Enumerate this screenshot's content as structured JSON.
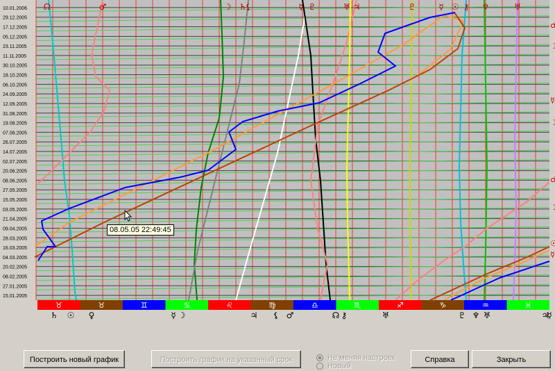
{
  "chart_data": {
    "type": "line",
    "dates": [
      "15.01.2005",
      "27.01.2005",
      "08.02.2005",
      "20.02.2005",
      "04.03.2005",
      "16.03.2005",
      "28.03.2005",
      "09.04.2005",
      "21.04.2005",
      "03.05.2005",
      "15.05.2005",
      "27.05.2005",
      "08.06.2005",
      "20.06.2005",
      "02.07.2005",
      "14.07.2005",
      "26.07.2005",
      "07.08.2005",
      "19.08.2005",
      "31.08.2005",
      "12.09.2005",
      "24.09.2005",
      "06.10.2005",
      "18.10.2005",
      "30.10.2005",
      "11.11.2005",
      "23.11.2005",
      "05.12.2005",
      "17.12.2005",
      "29.12.2005",
      "10.01.2006"
    ],
    "top_symbols": [
      "☊",
      "♂",
      "☽",
      "♄",
      "⚸",
      "☿",
      "♇",
      "♅",
      "♃",
      "♇",
      "☿",
      "☉",
      "⚷",
      "♆",
      "♅"
    ],
    "zodiac_bar": [
      {
        "glyph": "♉",
        "color": "#ff0000"
      },
      {
        "glyph": "♉",
        "color": "#804000"
      },
      {
        "glyph": "♊",
        "color": "#0000ff"
      },
      {
        "glyph": "♋",
        "color": "#00ff00"
      },
      {
        "glyph": "♌",
        "color": "#ff0000"
      },
      {
        "glyph": "♍",
        "color": "#804000"
      },
      {
        "glyph": "♎",
        "color": "#0000ff"
      },
      {
        "glyph": "♏",
        "color": "#00ff00"
      },
      {
        "glyph": "♐",
        "color": "#ff0000"
      },
      {
        "glyph": "♑",
        "color": "#804000"
      },
      {
        "glyph": "♒",
        "color": "#0000ff"
      },
      {
        "glyph": "♓",
        "color": "#00ff00"
      }
    ],
    "bottom_symbols": [
      "♄",
      "☉",
      "♀",
      "☿",
      "☽",
      "♃",
      "⚸",
      "♂",
      "☊",
      "⚷",
      "♅",
      "♇",
      "♆",
      "♅",
      "♃",
      "☿"
    ],
    "right_symbols": [
      "♂",
      "☽",
      "☿",
      "☽",
      "♂",
      "☽",
      "☉",
      "☿"
    ],
    "series": [
      {
        "color": "#00c8c8",
        "points": [
          [
            70,
            0
          ],
          [
            76,
            60
          ],
          [
            82,
            130
          ],
          [
            88,
            200
          ],
          [
            93,
            260
          ],
          [
            100,
            310
          ],
          [
            104,
            360
          ],
          [
            108,
            420
          ],
          [
            110,
            432
          ]
        ]
      },
      {
        "color": "#ff8080",
        "points": [
          [
            148,
            0
          ],
          [
            140,
            40
          ],
          [
            132,
            80
          ],
          [
            138,
            110
          ],
          [
            158,
            130
          ],
          [
            150,
            160
          ],
          [
            130,
            190
          ],
          [
            100,
            220
          ],
          [
            70,
            250
          ],
          [
            55,
            264
          ]
        ]
      },
      {
        "color": "#008000",
        "points": [
          [
            318,
            0
          ],
          [
            320,
            50
          ],
          [
            322,
            110
          ],
          [
            316,
            170
          ],
          [
            300,
            220
          ],
          [
            290,
            270
          ],
          [
            283,
            330
          ],
          [
            280,
            380
          ],
          [
            284,
            432
          ]
        ]
      },
      {
        "color": "#808080",
        "points": [
          [
            358,
            0
          ],
          [
            352,
            60
          ],
          [
            345,
            120
          ],
          [
            330,
            180
          ],
          [
            315,
            240
          ],
          [
            300,
            300
          ],
          [
            285,
            360
          ],
          [
            272,
            432
          ]
        ]
      },
      {
        "color": "#ffffff",
        "points": [
          [
            440,
            20
          ],
          [
            430,
            80
          ],
          [
            415,
            150
          ],
          [
            400,
            220
          ],
          [
            380,
            290
          ],
          [
            360,
            360
          ],
          [
            340,
            432
          ]
        ]
      },
      {
        "color": "#000000",
        "points": [
          [
            436,
            0
          ],
          [
            448,
            80
          ],
          [
            452,
            150
          ],
          [
            455,
            200
          ],
          [
            462,
            260
          ],
          [
            466,
            320
          ],
          [
            470,
            380
          ],
          [
            476,
            432
          ]
        ]
      },
      {
        "color": "#ff8080",
        "points": [
          [
            514,
            0
          ],
          [
            500,
            60
          ],
          [
            480,
            120
          ],
          [
            458,
            180
          ],
          [
            448,
            260
          ],
          [
            458,
            330
          ],
          [
            472,
            380
          ],
          [
            462,
            432
          ]
        ]
      },
      {
        "color": "#ffff00",
        "points": [
          [
            505,
            0
          ],
          [
            504,
            80
          ],
          [
            502,
            160
          ],
          [
            500,
            240
          ],
          [
            501,
            320
          ],
          [
            504,
            432
          ]
        ]
      },
      {
        "color": "#d4d400",
        "points": [
          [
            594,
            0
          ],
          [
            593,
            120
          ],
          [
            591,
            240
          ],
          [
            592,
            432
          ]
        ]
      },
      {
        "color": "#00c0e0",
        "points": [
          [
            672,
            0
          ],
          [
            666,
            80
          ],
          [
            664,
            160
          ],
          [
            662,
            240
          ],
          [
            664,
            320
          ],
          [
            668,
            380
          ],
          [
            672,
            432
          ]
        ]
      },
      {
        "color": "#00c000",
        "points": [
          [
            698,
            0
          ],
          [
            700,
            120
          ],
          [
            702,
            240
          ],
          [
            700,
            360
          ],
          [
            698,
            432
          ]
        ]
      },
      {
        "color": "#c080ff",
        "points": [
          [
            746,
            0
          ],
          [
            744,
            100
          ],
          [
            742,
            200
          ],
          [
            744,
            300
          ],
          [
            742,
            380
          ],
          [
            740,
            432
          ]
        ]
      },
      {
        "color": "#ff8080",
        "points": [
          [
            792,
            262
          ],
          [
            760,
            290
          ],
          [
            730,
            310
          ],
          [
            700,
            330
          ],
          [
            670,
            355
          ],
          [
            640,
            375
          ],
          [
            600,
            405
          ],
          [
            570,
            432
          ]
        ]
      },
      {
        "color": "#ff9a40",
        "points": [
          [
            50,
            355
          ],
          [
            100,
            320
          ],
          [
            200,
            270
          ],
          [
            300,
            220
          ],
          [
            400,
            165
          ],
          [
            500,
            110
          ],
          [
            580,
            65
          ],
          [
            640,
            22
          ],
          [
            668,
            30
          ],
          [
            650,
            70
          ],
          [
            600,
            110
          ]
        ]
      },
      {
        "color": "#c04000",
        "points": [
          [
            50,
            370
          ],
          [
            150,
            320
          ],
          [
            300,
            250
          ],
          [
            450,
            180
          ],
          [
            560,
            130
          ],
          [
            620,
            100
          ],
          [
            660,
            70
          ],
          [
            670,
            40
          ],
          [
            655,
            18
          ]
        ]
      },
      {
        "color": "#0000ff",
        "points": [
          [
            55,
            375
          ],
          [
            68,
            355
          ],
          [
            80,
            355
          ],
          [
            62,
            330
          ],
          [
            60,
            318
          ],
          [
            100,
            300
          ],
          [
            180,
            270
          ],
          [
            260,
            255
          ],
          [
            300,
            245
          ],
          [
            340,
            215
          ],
          [
            330,
            190
          ],
          [
            350,
            175
          ],
          [
            400,
            160
          ],
          [
            460,
            148
          ],
          [
            520,
            120
          ],
          [
            570,
            95
          ],
          [
            545,
            75
          ],
          [
            555,
            48
          ],
          [
            620,
            25
          ],
          [
            656,
            18
          ]
        ]
      },
      {
        "color": "#ff9a40",
        "points": [
          [
            640,
            432
          ],
          [
            700,
            400
          ],
          [
            760,
            375
          ],
          [
            792,
            360
          ]
        ]
      },
      {
        "color": "#c04000",
        "points": [
          [
            620,
            432
          ],
          [
            700,
            395
          ],
          [
            760,
            370
          ],
          [
            792,
            355
          ]
        ]
      },
      {
        "color": "#0000ff",
        "points": [
          [
            650,
            432
          ],
          [
            720,
            400
          ],
          [
            792,
            376
          ]
        ]
      }
    ]
  },
  "tooltip": "08.05.05 22:49:45",
  "buttons": {
    "new_chart": "Построить новый график",
    "chart_on_date": "Построить график на указанный срок",
    "help": "Справка",
    "close": "Закрыть"
  },
  "radio": {
    "keep": "Не меняя настроек",
    "new": "Новый"
  }
}
